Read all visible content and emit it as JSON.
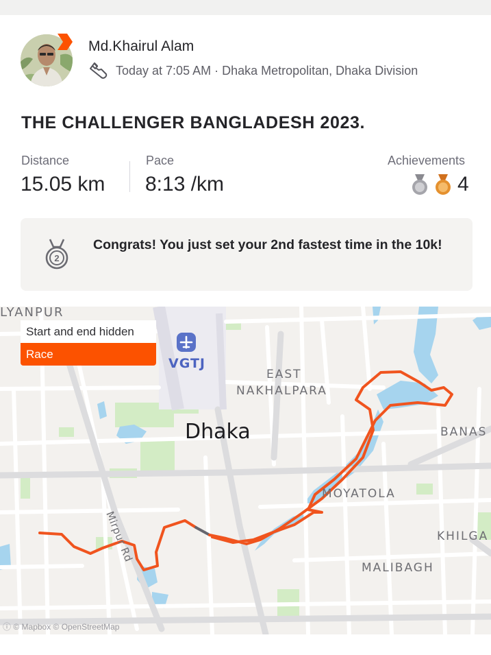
{
  "athlete": {
    "name": "Md.Khairul Alam",
    "meta": "Today at 7:05 AM · Dhaka Metropolitan, Dhaka Division"
  },
  "activity": {
    "title": "THE CHALLENGER BANGLADESH 2023."
  },
  "stats": {
    "distance_label": "Distance",
    "distance_value": "15.05 km",
    "pace_label": "Pace",
    "pace_value": "8:13 /km",
    "achievements_label": "Achievements",
    "achievements_count": "4"
  },
  "congrats": {
    "medal_number": "2",
    "text": "Congrats! You just set your 2nd fastest time in the 10k!"
  },
  "map": {
    "chip_hidden": "Start and end hidden",
    "chip_race": "Race",
    "labels": {
      "lyanpur": "LYANPUR",
      "airport": "VGTJ",
      "east": "EAST",
      "nakhalpara": "NAKHALPARA",
      "city": "Dhaka",
      "banas": "BANAS",
      "moyatola": "MOYATOLA",
      "khilga": "KHILGA",
      "malibagh": "MALIBAGH",
      "road": "Mirpur Rd"
    },
    "attribution": "© Mapbox © OpenStreetMap"
  },
  "colors": {
    "brand_orange": "#fc5200",
    "route": "#f0541e",
    "water": "#a6d4ee",
    "park": "#d3ecc5"
  }
}
